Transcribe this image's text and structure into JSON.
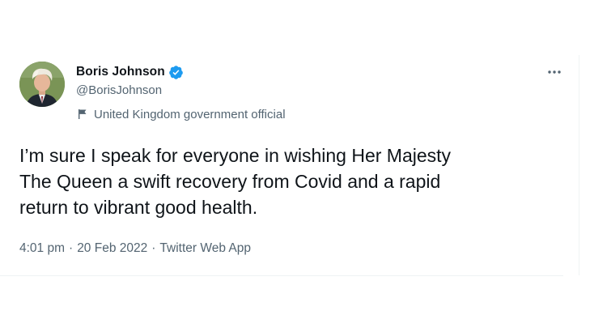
{
  "tweet": {
    "author": {
      "display_name": "Boris Johnson",
      "handle": "@BorisJohnson",
      "verified": true,
      "label": "United Kingdom government official"
    },
    "text_lines": [
      "I’m sure I speak for everyone in wishing Her Majesty",
      "The Queen a swift recovery from Covid and a rapid",
      "return to vibrant good health."
    ],
    "meta": {
      "time": "4:01 pm",
      "separator": "·",
      "date": "20 Feb 2022",
      "source": "Twitter Web App"
    },
    "more_menu": "•••"
  },
  "colors": {
    "verified_blue": "#1d9bf0",
    "text_primary": "#0f1419",
    "text_secondary": "#536471",
    "divider": "#eff3f4"
  },
  "icons": {
    "verified": "verified-badge-icon",
    "label": "flag-icon",
    "more": "more-options-icon"
  }
}
